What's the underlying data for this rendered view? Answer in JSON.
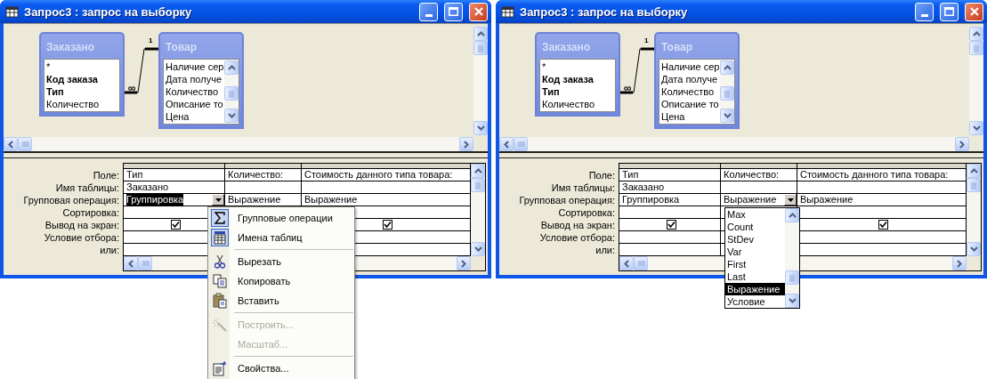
{
  "windows": [
    {
      "title": "Запрос3 : запрос на выборку",
      "tables": [
        {
          "name": "Заказано",
          "fields": [
            {
              "name": "*",
              "key": false
            },
            {
              "name": "Код заказа",
              "key": true
            },
            {
              "name": "Тип",
              "key": true
            },
            {
              "name": "Количество",
              "key": false
            }
          ]
        },
        {
          "name": "Товар",
          "fields": [
            {
              "name": "Наличие сер",
              "key": false
            },
            {
              "name": "Дата получе",
              "key": false
            },
            {
              "name": "Количество",
              "key": false
            },
            {
              "name": "Описание то",
              "key": false
            },
            {
              "name": "Цена",
              "key": false
            }
          ]
        }
      ],
      "join": {
        "one": "1",
        "many": "∞"
      },
      "grid": {
        "row_labels": [
          "Поле:",
          "Имя таблицы:",
          "Групповая операция:",
          "Сортировка:",
          "Вывод на экран:",
          "Условие отбора:",
          "или:"
        ],
        "columns": [
          {
            "field": "Тип",
            "table": "Заказано",
            "total": "Группировка",
            "total_selected": true,
            "dropdown": true,
            "show": true
          },
          {
            "field": "Количество:",
            "total": "Выражение",
            "total_selected": false,
            "dropdown": false
          },
          {
            "field": "Стоимость данного типа товара:",
            "total": "Выражение",
            "total_selected": false,
            "dropdown": false,
            "show": true
          }
        ]
      },
      "context_menu": {
        "items": [
          {
            "kind": "item",
            "label": "Групповые операции",
            "checked": true,
            "disabled": false
          },
          {
            "kind": "item",
            "label": "Имена таблиц",
            "checked": true,
            "disabled": false
          },
          {
            "kind": "separator"
          },
          {
            "kind": "item",
            "label": "Вырезать",
            "checked": false,
            "disabled": false
          },
          {
            "kind": "item",
            "label": "Копировать",
            "checked": false,
            "disabled": false
          },
          {
            "kind": "item",
            "label": "Вставить",
            "checked": false,
            "disabled": false
          },
          {
            "kind": "separator"
          },
          {
            "kind": "item",
            "label": "Построить...",
            "checked": false,
            "disabled": true
          },
          {
            "kind": "item",
            "label": "Масштаб...",
            "checked": false,
            "disabled": true
          },
          {
            "kind": "separator"
          },
          {
            "kind": "item",
            "label": "Свойства...",
            "checked": false,
            "disabled": false
          }
        ]
      }
    },
    {
      "title": "Запрос3 : запрос на выборку",
      "tables": [
        {
          "name": "Заказано",
          "fields": [
            {
              "name": "*",
              "key": false
            },
            {
              "name": "Код заказа",
              "key": true
            },
            {
              "name": "Тип",
              "key": true
            },
            {
              "name": "Количество",
              "key": false
            }
          ]
        },
        {
          "name": "Товар",
          "fields": [
            {
              "name": "Наличие сер",
              "key": false
            },
            {
              "name": "Дата получе",
              "key": false
            },
            {
              "name": "Количество",
              "key": false
            },
            {
              "name": "Описание то",
              "key": false
            },
            {
              "name": "Цена",
              "key": false
            }
          ]
        }
      ],
      "join": {
        "one": "1",
        "many": "∞"
      },
      "grid": {
        "row_labels": [
          "Поле:",
          "Имя таблицы:",
          "Групповая операция:",
          "Сортировка:",
          "Вывод на экран:",
          "Условие отбора:",
          "или:"
        ],
        "columns": [
          {
            "field": "Тип",
            "table": "Заказано",
            "total": "Группировка",
            "total_selected": false,
            "dropdown": false,
            "show": true
          },
          {
            "field": "Количество:",
            "total": "Выражение",
            "total_selected": false,
            "dropdown": true
          },
          {
            "field": "Стоимость данного типа товара:",
            "total": "Выражение",
            "total_selected": false,
            "dropdown": false,
            "show": true
          }
        ]
      },
      "dropdown_list": {
        "items": [
          {
            "label": "Max",
            "selected": false
          },
          {
            "label": "Count",
            "selected": false
          },
          {
            "label": "StDev",
            "selected": false
          },
          {
            "label": "Var",
            "selected": false
          },
          {
            "label": "First",
            "selected": false
          },
          {
            "label": "Last",
            "selected": false
          },
          {
            "label": "Выражение",
            "selected": true
          },
          {
            "label": "Условие",
            "selected": false
          }
        ]
      }
    }
  ]
}
